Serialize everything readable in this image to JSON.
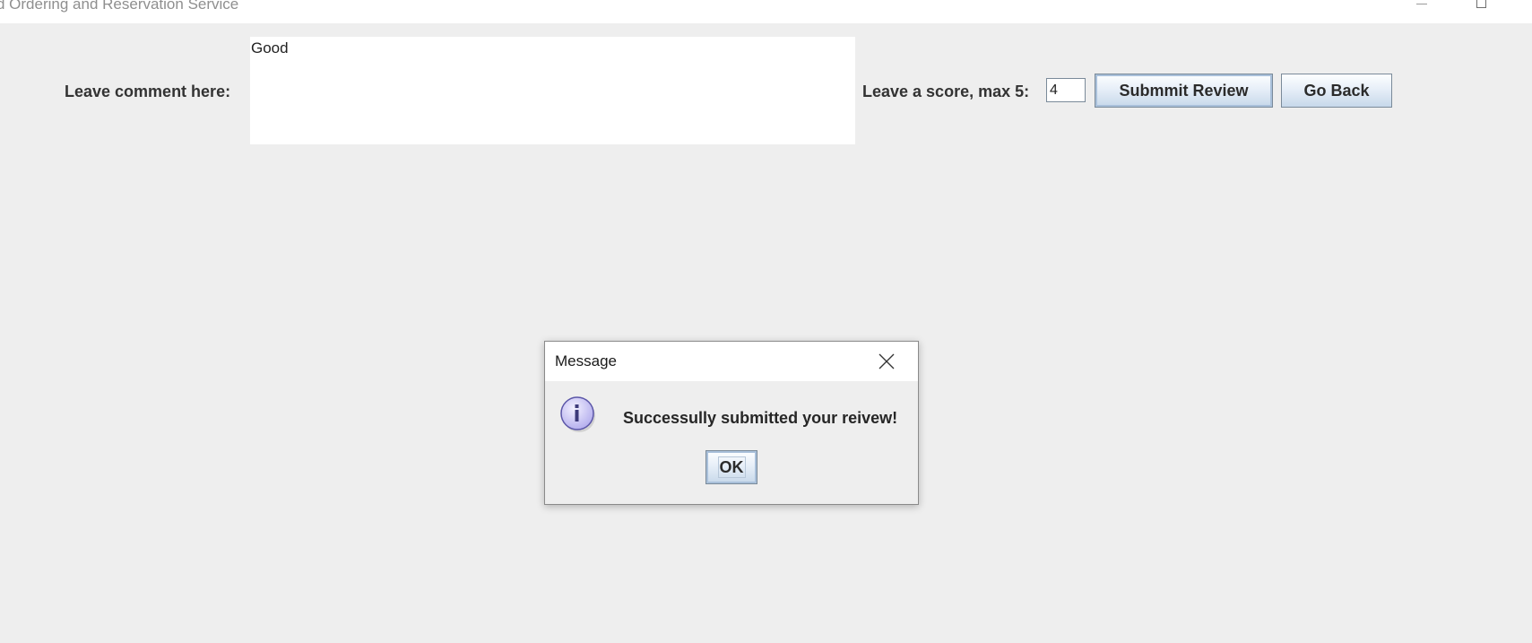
{
  "window": {
    "title": "d Ordering and Reservation Service"
  },
  "form": {
    "comment_label": "Leave comment here:",
    "comment_value": "Good",
    "score_label": "Leave a score, max 5:",
    "score_value": "4",
    "submit_label": "Submmit Review",
    "back_label": "Go Back"
  },
  "dialog": {
    "title": "Message",
    "message": "Successully submitted your reivew!",
    "ok_label": "OK",
    "icon": "information-icon"
  },
  "colors": {
    "background": "#eeeeee",
    "button_gradient_top": "#fdfeff",
    "button_gradient_bottom": "#c7d8ea",
    "info_icon_fill": "#c8c4f5"
  }
}
